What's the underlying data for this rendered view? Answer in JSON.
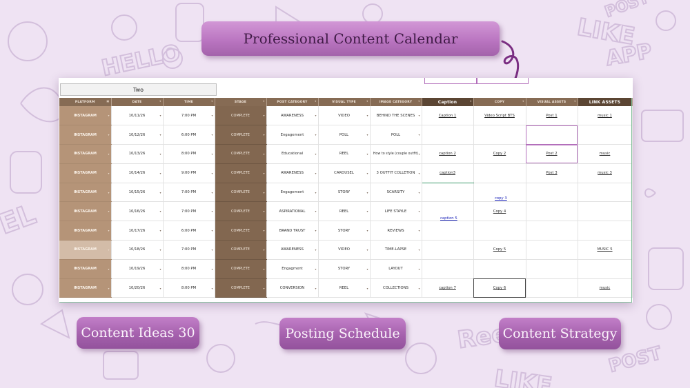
{
  "title": "Professional Content Calendar",
  "buttons": {
    "content_ideas": "Content Ideas 30",
    "posting_schedule": "Posting Schedule",
    "content_strategy": "Content Strategy"
  },
  "background_doodles": [
    "HELLO",
    "LIKE",
    "APP",
    "POST",
    "Reel",
    "LIKE",
    "POST",
    "EL"
  ],
  "sheet": {
    "selector_value": "Two",
    "columns": [
      "PLATFORM",
      "DATE",
      "TIME",
      "STAGE",
      "POST CATEGORY",
      "VISUAL TYPE",
      "IMAGE CATEGORY",
      "Caption",
      "COPY",
      "VISUAL ASSETS",
      "LINK ASSETS"
    ],
    "rows": [
      {
        "platform": "INSTAGRAM",
        "date": "10/11/26",
        "time": "7:00 PM",
        "stage": "COMPLETE",
        "category": "AWARENESS",
        "type": "VIDEO",
        "image": "BEHIND THE SCENES",
        "caption": "Caption 1",
        "copy": "Video Script BTS",
        "visual": "Post 1",
        "link": "music 1"
      },
      {
        "platform": "INSTAGRAM",
        "date": "10/12/26",
        "time": "6:00 PM",
        "stage": "COMPLETE",
        "category": "Engagement",
        "type": "POLL",
        "image": "POLL",
        "caption": "",
        "copy": "",
        "visual": "",
        "link": ""
      },
      {
        "platform": "INSTAGRAM",
        "date": "10/13/26",
        "time": "8:00 PM",
        "stage": "COMPLETE",
        "category": "Educational",
        "type": "REEL",
        "image": "How to style (couple outfit)",
        "caption": "caption 2",
        "copy": "Copy 2",
        "visual": "Post 2",
        "link": "music"
      },
      {
        "platform": "INSTAGRAM",
        "date": "10/14/26",
        "time": "9:00 PM",
        "stage": "COMPLETE",
        "category": "AWARENESS",
        "type": "CAROUSEL",
        "image": "3 OUTFIT COLLETION",
        "caption": "caption3",
        "copy": "",
        "visual": "Post 3",
        "link": "music 3"
      },
      {
        "platform": "INSTAGRAM",
        "date": "10/15/26",
        "time": "7:00 PM",
        "stage": "COMPLETE",
        "category": "Engagement",
        "type": "STORY",
        "image": "SCARSITY",
        "caption": "",
        "copy": "",
        "visual": "",
        "link": ""
      },
      {
        "platform": "INSTAGRAM",
        "date": "10/16/26",
        "time": "7:00 PM",
        "stage": "COMPLETE",
        "category": "ASPIRATIONAL",
        "type": "REEL",
        "image": "LIFE STAYLE",
        "caption": "",
        "copy": "Copy 4",
        "visual": "",
        "link": ""
      },
      {
        "platform": "INSTAGRAM",
        "date": "10/17/26",
        "time": "6:00 PM",
        "stage": "COMPLETE",
        "category": "BRAND TRUST",
        "type": "STORY",
        "image": "REVIEWS",
        "caption": "",
        "copy": "",
        "visual": "",
        "link": ""
      },
      {
        "platform": "INSTAGRAM",
        "date": "10/18/26",
        "time": "7:00 PM",
        "stage": "COMPLETE",
        "category": "AWARENESS",
        "type": "VIDEO",
        "image": "TIME-LAPSE",
        "caption": "",
        "copy": "Copy 5",
        "visual": "",
        "link": "MUSIC 5"
      },
      {
        "platform": "INSTAGRAM",
        "date": "10/19/26",
        "time": "8:00 PM",
        "stage": "COMPLETE",
        "category": "Engagment",
        "type": "STORY",
        "image": "LAYOUT",
        "caption": "",
        "copy": "",
        "visual": "",
        "link": ""
      },
      {
        "platform": "INSTAGRAM",
        "date": "10/20/26",
        "time": "8:00 PM",
        "stage": "COMPLETE",
        "category": "CONVERSION",
        "type": "REEL",
        "image": "COLLECTIONS",
        "caption": "caption 7",
        "copy": "Copy 6",
        "visual": "",
        "link": "music"
      }
    ],
    "floating_links": {
      "copy_3": "copy 3",
      "caption_5": "caption 5"
    }
  }
}
